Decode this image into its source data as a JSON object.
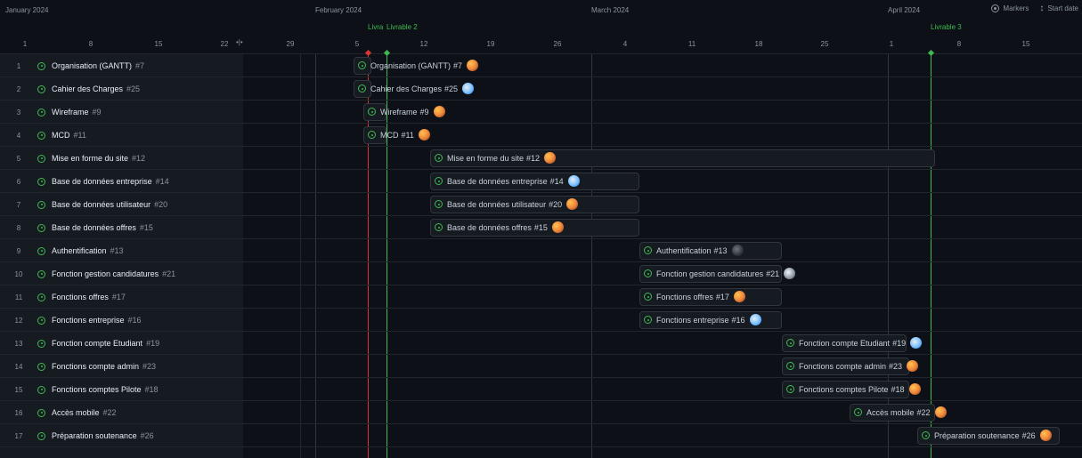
{
  "header": {
    "months": [
      {
        "label": "January 2024"
      },
      {
        "label": "February 2024"
      },
      {
        "label": "March 2024"
      },
      {
        "label": "April 2024"
      }
    ],
    "days": [
      "1",
      "8",
      "15",
      "22",
      "29",
      "5",
      "12",
      "19",
      "26",
      "4",
      "11",
      "18",
      "25",
      "1",
      "8",
      "15"
    ],
    "markers": [
      {
        "label": "Livra"
      },
      {
        "label": "Livrable 2"
      },
      {
        "label": "Livrable 3"
      }
    ],
    "toolbar": {
      "markers_label": "Markers",
      "start_date_label": "Start date"
    },
    "divider_glyph": "•|•"
  },
  "rows": [
    {
      "num": "1",
      "title": "Organisation (GANTT)",
      "issue": "#7",
      "avatar": "orange"
    },
    {
      "num": "2",
      "title": "Cahier des Charges",
      "issue": "#25",
      "avatar": "blue"
    },
    {
      "num": "3",
      "title": "Wireframe",
      "issue": "#9",
      "avatar": "orange"
    },
    {
      "num": "4",
      "title": "MCD",
      "issue": "#11",
      "avatar": "orange"
    },
    {
      "num": "5",
      "title": "Mise en forme du site",
      "issue": "#12",
      "avatar": "orange"
    },
    {
      "num": "6",
      "title": "Base de données entreprise",
      "issue": "#14",
      "avatar": "blue"
    },
    {
      "num": "7",
      "title": "Base de données utilisateur",
      "issue": "#20",
      "avatar": "orange"
    },
    {
      "num": "8",
      "title": "Base de données offres",
      "issue": "#15",
      "avatar": "orange"
    },
    {
      "num": "9",
      "title": "Authentification",
      "issue": "#13",
      "avatar": "dark"
    },
    {
      "num": "10",
      "title": "Fonction gestion candidatures",
      "issue": "#21",
      "avatar": "grey"
    },
    {
      "num": "11",
      "title": "Fonctions offres",
      "issue": "#17",
      "avatar": "orange"
    },
    {
      "num": "12",
      "title": "Fonctions entreprise",
      "issue": "#16",
      "avatar": "blue"
    },
    {
      "num": "13",
      "title": "Fonction compte Etudiant",
      "issue": "#19",
      "avatar": "blue"
    },
    {
      "num": "14",
      "title": "Fonctions compte admin",
      "issue": "#23",
      "avatar": "orange"
    },
    {
      "num": "15",
      "title": "Fonctions comptes Pilote",
      "issue": "#18",
      "avatar": "orange"
    },
    {
      "num": "16",
      "title": "Accès mobile",
      "issue": "#22",
      "avatar": "orange"
    },
    {
      "num": "17",
      "title": "Préparation soutenance",
      "issue": "#26",
      "avatar": "orange"
    }
  ],
  "colors": {
    "background": "#0d1117",
    "panel": "#161b22",
    "grid": "#21262d",
    "accent_green": "#3fb950",
    "today_red": "#da3633",
    "text": "#e6edf3",
    "muted": "#8b949e"
  }
}
